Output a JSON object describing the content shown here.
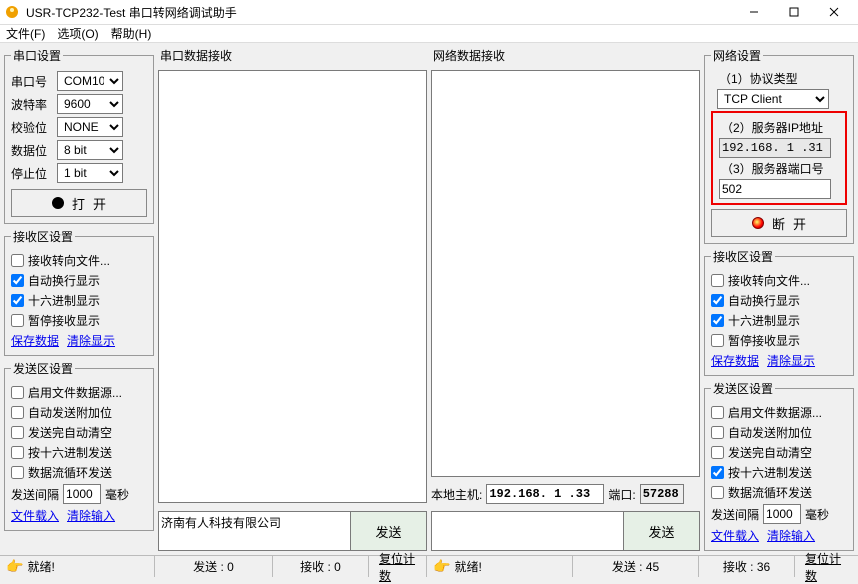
{
  "window": {
    "title": "USR-TCP232-Test 串口转网络调试助手"
  },
  "menu": {
    "file": "文件(F)",
    "options": "选项(O)",
    "help": "帮助(H)"
  },
  "serial": {
    "legend": "串口设置",
    "port_lbl": "串口号",
    "port": "COM10",
    "baud_lbl": "波特率",
    "baud": "9600",
    "parity_lbl": "校验位",
    "parity": "NONE",
    "databits_lbl": "数据位",
    "databits": "8 bit",
    "stopbits_lbl": "停止位",
    "stopbits": "1 bit",
    "open_btn": "打开"
  },
  "recv_opts_l": {
    "legend": "接收区设置",
    "redirect": "接收转向文件...",
    "wrap": "自动换行显示",
    "hex": "十六进制显示",
    "pause": "暂停接收显示",
    "save": "保存数据",
    "clear": "清除显示"
  },
  "send_opts_l": {
    "legend": "发送区设置",
    "file": "启用文件数据源...",
    "auto_extra": "自动发送附加位",
    "clear_after": "发送完自动清空",
    "hex_send": "按十六进制发送",
    "loop": "数据流循环发送",
    "interval_lbl": "发送间隔",
    "interval": "1000",
    "ms": "毫秒",
    "load": "文件载入",
    "clear": "清除输入"
  },
  "mid_l": {
    "header": "串口数据接收",
    "send_text": "济南有人科技有限公司",
    "send_btn": "发送"
  },
  "mid_r": {
    "header": "网络数据接收",
    "host_lbl": "本地主机:",
    "host_ip": "192.168. 1 .33",
    "port_lbl": "端口:",
    "port": "57288",
    "send_text": "",
    "send_btn": "发送"
  },
  "net": {
    "legend": "网络设置",
    "proto_lbl": "（1）协议类型",
    "proto": "TCP Client",
    "ip_lbl": "（2）服务器IP地址",
    "ip": "192.168. 1 .31",
    "port_lbl": "（3）服务器端口号",
    "port": "502",
    "disconnect_btn": "断开"
  },
  "recv_opts_r": {
    "legend": "接收区设置",
    "redirect": "接收转向文件...",
    "wrap": "自动换行显示",
    "hex": "十六进制显示",
    "pause": "暂停接收显示",
    "save": "保存数据",
    "clear": "清除显示"
  },
  "send_opts_r": {
    "legend": "发送区设置",
    "file": "启用文件数据源...",
    "auto_extra": "自动发送附加位",
    "clear_after": "发送完自动清空",
    "hex_send": "按十六进制发送",
    "loop": "数据流循环发送",
    "interval_lbl": "发送间隔",
    "interval": "1000",
    "ms": "毫秒",
    "load": "文件载入",
    "clear": "清除输入"
  },
  "status_l": {
    "ready": "就绪!",
    "send": "发送 : 0",
    "recv": "接收 : 0",
    "reset": "复位计数"
  },
  "status_r": {
    "ready": "就绪!",
    "send": "发送 : 45",
    "recv": "接收 : 36",
    "reset": "复位计数"
  }
}
